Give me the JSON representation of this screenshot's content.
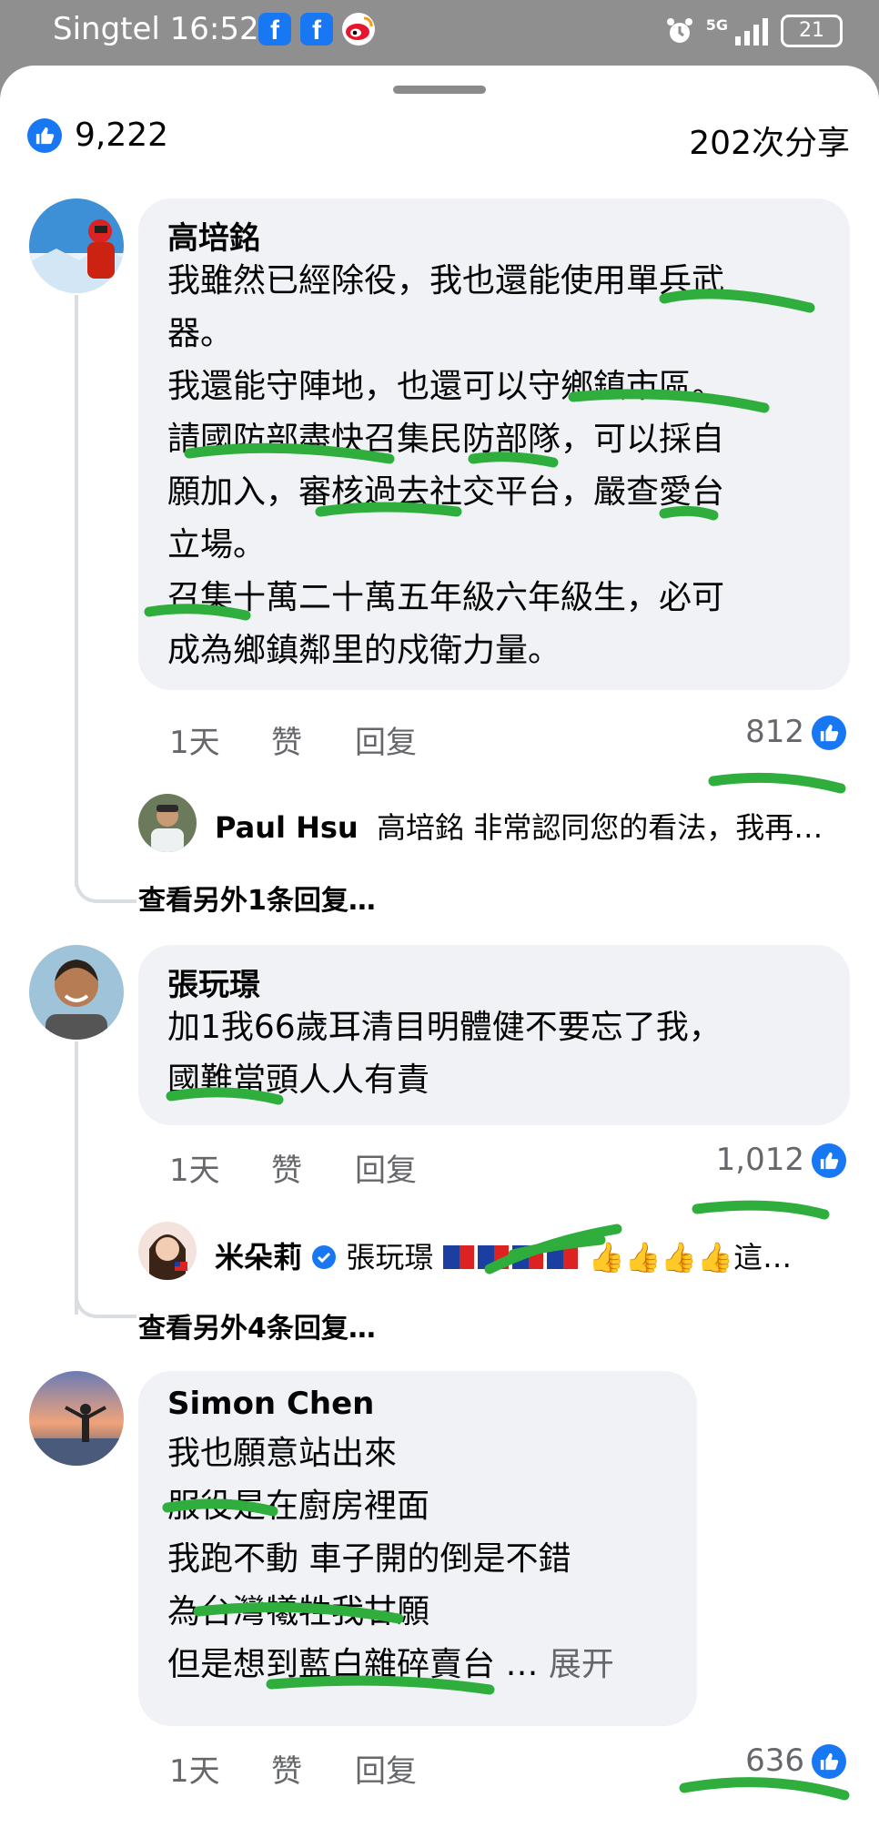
{
  "status_bar": {
    "carrier_time": "Singtel 16:52",
    "network": "5G",
    "battery": "21",
    "icons": [
      "facebook-icon",
      "facebook-icon",
      "weibo-icon",
      "alarm-icon",
      "signal-icon"
    ]
  },
  "summary": {
    "likes": "9,222",
    "shares": "202次分享"
  },
  "actions": {
    "time": "1天",
    "like": "赞",
    "reply": "回复"
  },
  "comments": [
    {
      "author": "高培銘",
      "text": "我雖然已經除役，我也還能使用單兵武\n器。\n我還能守陣地，也還可以守鄉鎮市區。\n請國防部盡快召集民防部隊，可以採自\n願加入，審核過去社交平台，嚴查愛台\n立場。\n召集十萬二十萬五年級六年級生，必可\n成為鄉鎮鄰里的戍衛力量。",
      "likes": "812",
      "reply": {
        "name": "Paul Hsu",
        "text": "高培銘 非常認同您的看法，我再…"
      },
      "more_replies": "查看另外1条回复…"
    },
    {
      "author": "張玩璟",
      "text": "加1我66歲耳清目明體健不要忘了我，\n國難當頭人人有責",
      "likes": "1,012",
      "reply": {
        "name": "米朵莉",
        "target": "張玩璟",
        "text": "👍👍👍👍這…"
      },
      "more_replies": "查看另外4条回复…"
    },
    {
      "author": "Simon Chen",
      "text": "我也願意站出來\n服役是在廚房裡面\n我跑不動  車子開的倒是不錯\n為台灣犧牲我甘願\n但是想到藍白雜碎賣台 …",
      "expand": "展开",
      "likes": "636"
    }
  ],
  "colors": {
    "facebook_blue": "#1877f2",
    "bubble": "#f0f2f5",
    "scribble_green": "#2fae3d",
    "meta_gray": "#65676b"
  }
}
